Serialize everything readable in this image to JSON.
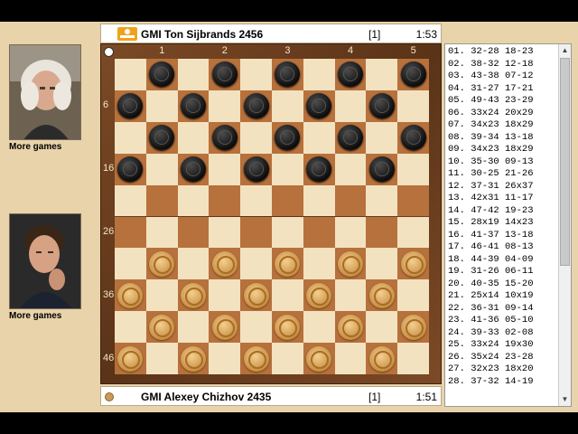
{
  "top_player": {
    "name": "GMI Ton Sijbrands 2456",
    "score": "[1]",
    "clock": "1:53"
  },
  "bottom_player": {
    "name": "GMI Alexey Chizhov 2435",
    "score": "[1]",
    "clock": "1:51"
  },
  "left_panel": {
    "more_games_top": "More games",
    "more_games_bottom": "More games"
  },
  "board": {
    "top_coords": [
      "1",
      "2",
      "3",
      "4",
      "5"
    ],
    "left_coords": [
      "6",
      "16",
      "26",
      "36",
      "46"
    ],
    "colors": {
      "light": "#f3e2c0",
      "dark": "#b7713c",
      "black_piece": "#111111",
      "white_piece": "#d9a55b"
    },
    "black_pieces": [
      1,
      2,
      3,
      4,
      5,
      6,
      7,
      8,
      9,
      10,
      11,
      12,
      13,
      14,
      15,
      16,
      17,
      18,
      19,
      20
    ],
    "white_pieces": [
      31,
      32,
      33,
      34,
      35,
      36,
      37,
      38,
      39,
      40,
      41,
      42,
      43,
      44,
      45,
      46,
      47,
      48,
      49,
      50
    ]
  },
  "moves": [
    "01. 32-28 18-23",
    "02. 38-32 12-18",
    "03. 43-38 07-12",
    "04. 31-27 17-21",
    "05. 49-43 23-29",
    "06. 33x24 20x29",
    "07. 34x23 18x29",
    "08. 39-34 13-18",
    "09. 34x23 18x29",
    "10. 35-30 09-13",
    "11. 30-25 21-26",
    "12. 37-31 26x37",
    "13. 42x31 11-17",
    "14. 47-42 19-23",
    "15. 28x19 14x23",
    "16. 41-37 13-18",
    "17. 46-41 08-13",
    "18. 44-39 04-09",
    "19. 31-26 06-11",
    "20. 40-35 15-20",
    "21. 25x14 10x19",
    "22. 36-31 09-14",
    "23. 41-36 05-10",
    "24. 39-33 02-08",
    "25. 33x24 19x30",
    "26. 35x24 23-28",
    "27. 32x23 18x20",
    "28. 37-32 14-19"
  ]
}
